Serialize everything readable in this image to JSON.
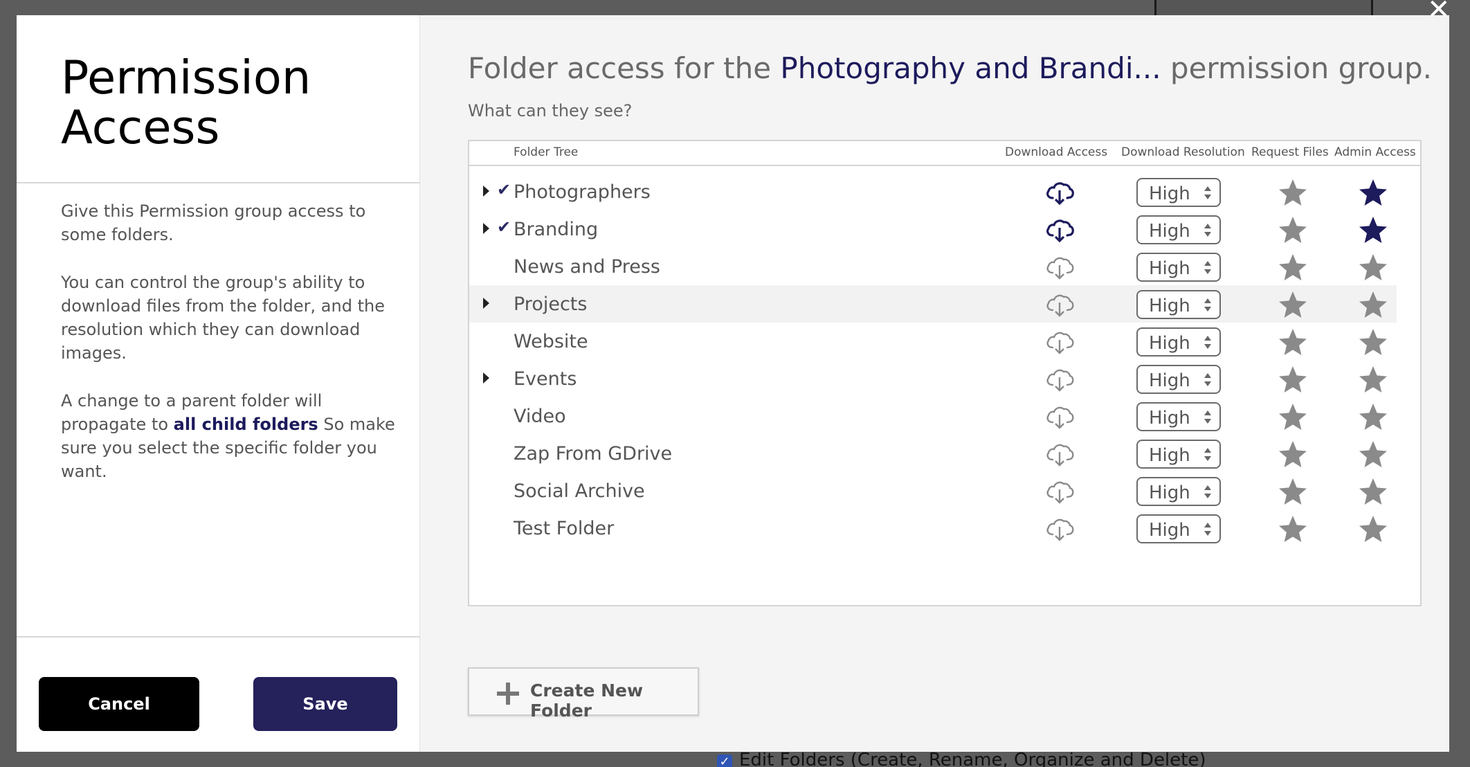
{
  "backdrop": {
    "close_glyph": "✕",
    "edit_folders_label": "Edit Folders (Create, Rename, Organize and Delete)"
  },
  "left_panel": {
    "title": "Permission Access",
    "paragraph1": "Give this Permission group access to some folders.",
    "paragraph2": "You can control the group's ability to download files from the folder, and the resolution which they can download images.",
    "paragraph3_pre": "A change to a parent folder will propagate to ",
    "paragraph3_bold": "all child folders",
    "paragraph3_post": " So make sure you select the specific folder you want.",
    "cancel_label": "Cancel",
    "save_label": "Save"
  },
  "right_panel": {
    "heading_pre": "Folder access for the ",
    "group_name": "Photography and Brandi...",
    "heading_post": " permission group.",
    "subheading": "What can they see?",
    "columns": {
      "folder_tree": "Folder Tree",
      "download_access": "Download Access",
      "download_resolution": "Download Resolution",
      "request_files": "Request Files",
      "admin_access": "Admin Access"
    },
    "folders": [
      {
        "name": "Photographers",
        "has_children": true,
        "checked": true,
        "download": true,
        "resolution": "High",
        "request": false,
        "admin": true
      },
      {
        "name": "Branding",
        "has_children": true,
        "checked": true,
        "download": true,
        "resolution": "High",
        "request": false,
        "admin": true
      },
      {
        "name": "News and Press",
        "has_children": false,
        "checked": false,
        "download": false,
        "resolution": "High",
        "request": false,
        "admin": false
      },
      {
        "name": "Projects",
        "has_children": true,
        "checked": false,
        "download": false,
        "resolution": "High",
        "request": false,
        "admin": false
      },
      {
        "name": "Website",
        "has_children": false,
        "checked": false,
        "download": false,
        "resolution": "High",
        "request": false,
        "admin": false
      },
      {
        "name": "Events",
        "has_children": true,
        "checked": false,
        "download": false,
        "resolution": "High",
        "request": false,
        "admin": false
      },
      {
        "name": "Video",
        "has_children": false,
        "checked": false,
        "download": false,
        "resolution": "High",
        "request": false,
        "admin": false
      },
      {
        "name": "Zap From GDrive",
        "has_children": false,
        "checked": false,
        "download": false,
        "resolution": "High",
        "request": false,
        "admin": false
      },
      {
        "name": "Social Archive",
        "has_children": false,
        "checked": false,
        "download": false,
        "resolution": "High",
        "request": false,
        "admin": false
      },
      {
        "name": "Test Folder",
        "has_children": false,
        "checked": false,
        "download": false,
        "resolution": "High",
        "request": false,
        "admin": false
      }
    ],
    "create_folder_label": "Create New Folder"
  },
  "colors": {
    "active": "#1d1b5c",
    "inactive": "#8a8a8a",
    "save_button": "#24215b",
    "cancel_button": "#000000"
  }
}
